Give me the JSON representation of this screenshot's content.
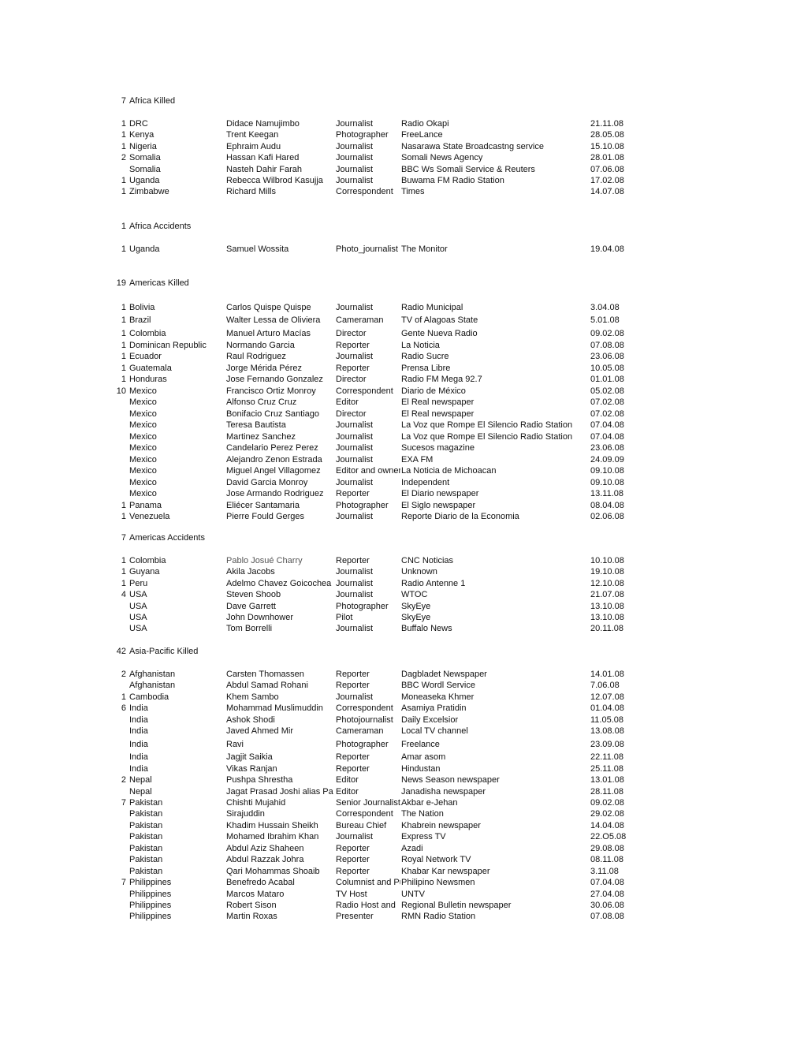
{
  "sections": [
    {
      "count": "7",
      "title": "Africa Killed",
      "rows": [
        {
          "count": "1",
          "country": "DRC",
          "name": "Didace Namujimbo",
          "role": "Journalist",
          "outlet": "Radio Okapi",
          "date": "21.11.08"
        },
        {
          "count": "1",
          "country": "Kenya",
          "name": "Trent Keegan",
          "role": "Photographer",
          "outlet": "FreeLance",
          "date": "28.05.08"
        },
        {
          "count": "1",
          "country": "Nigeria",
          "name": "Ephraim Audu",
          "role": "Journalist",
          "outlet": "Nasarawa State Broadcastng service",
          "date": "15.10.08"
        },
        {
          "count": "2",
          "country": "Somalia",
          "name": "Hassan Kafi Hared",
          "role": "Journalist",
          "outlet": "Somali News Agency",
          "date": "28.01.08"
        },
        {
          "count": "",
          "country": "Somalia",
          "name": "Nasteh Dahir Farah",
          "role": "Journalist",
          "outlet": "BBC Ws Somali Service & Reuters",
          "date": "07.06.08"
        },
        {
          "count": "1",
          "country": "Uganda",
          "name": "Rebecca Wilbrod Kasujja",
          "role": "Journalist",
          "outlet": "Buwama FM Radio Station",
          "date": "17.02.08"
        },
        {
          "count": "1",
          "country": "Zimbabwe",
          "name": "Richard Mills",
          "role": "Correspondent",
          "outlet": "Times",
          "date": "14.07.08"
        }
      ]
    },
    {
      "count": "1",
      "title": "Africa Accidents",
      "rows": [
        {
          "count": "1",
          "country": "Uganda",
          "name": "Samuel Wossita",
          "role": "Photo_journalist",
          "outlet": "The Monitor",
          "date": "19.04.08"
        }
      ]
    },
    {
      "count": "19",
      "title": "Americas Killed",
      "rows": [
        {
          "count": "1",
          "country": "Bolivia",
          "name": "Carlos Quispe Quispe",
          "role": "Journalist",
          "outlet": "Radio Municipal",
          "date": "3.04.08"
        },
        {
          "count": "1",
          "country": "Brazil",
          "name": "Walter Lessa de Oliviera",
          "role": "Cameraman",
          "outlet": "TV of Alagoas State",
          "date": "5.01.08"
        },
        {
          "count": "1",
          "country": "Colombia",
          "name": "Manuel Arturo Macías",
          "role": "Director",
          "outlet": "Gente Nueva Radio",
          "date": "09.02.08"
        },
        {
          "count": "1",
          "country": "Dominican Republic",
          "name": "Normando Garcia",
          "role": "Reporter",
          "outlet": "La Noticia",
          "date": "07.08.08"
        },
        {
          "count": "1",
          "country": "Ecuador",
          "name": "Raul Rodriguez",
          "role": "Journalist",
          "outlet": "Radio Sucre",
          "date": "23.06.08"
        },
        {
          "count": "1",
          "country": "Guatemala",
          "name": "Jorge Mérida Pérez",
          "role": "Reporter",
          "outlet": "Prensa Libre",
          "date": "10.05.08"
        },
        {
          "count": "1",
          "country": "Honduras",
          "name": "Jose Fernando Gonzalez",
          "role": "Director",
          "outlet": "Radio FM Mega 92.7",
          "date": "01.01.08"
        },
        {
          "count": "10",
          "country": "Mexico",
          "name": "Francisco Ortiz Monroy",
          "role": "Correspondent",
          "outlet": "Diario de México",
          "date": "05.02.08"
        },
        {
          "count": "",
          "country": "Mexico",
          "name": "Alfonso Cruz Cruz",
          "role": "Editor",
          "outlet": "El Real newspaper",
          "date": "07.02.08"
        },
        {
          "count": "",
          "country": "Mexico",
          "name": "Bonifacio Cruz Santiago",
          "role": "Director",
          "outlet": "El Real newspaper",
          "date": "07.02.08"
        },
        {
          "count": "",
          "country": "Mexico",
          "name": "Teresa Bautista",
          "role": "Journalist",
          "outlet": "La Voz que Rompe El Silencio Radio Station",
          "date": "07.04.08"
        },
        {
          "count": "",
          "country": "Mexico",
          "name": "Martinez Sanchez",
          "role": "Journalist",
          "outlet": "La Voz que Rompe El Silencio Radio Station",
          "date": "07.04.08"
        },
        {
          "count": "",
          "country": "Mexico",
          "name": "Candelario Perez Perez",
          "role": "Journalist",
          "outlet": "Sucesos magazine",
          "date": "23.06.08"
        },
        {
          "count": "",
          "country": "Mexico",
          "name": "Alejandro Zenon Estrada",
          "role": "Journalist",
          "outlet": "EXA FM",
          "date": "24.09.09"
        },
        {
          "count": "",
          "country": "Mexico",
          "name": "Miguel Angel Villagomez",
          "role": "Editor and owner",
          "outlet": "La Noticia de Michoacan",
          "date": "09.10.08"
        },
        {
          "count": "",
          "country": "Mexico",
          "name": "David Garcia Monroy",
          "role": "Journalist",
          "outlet": "Independent",
          "date": "09.10.08"
        },
        {
          "count": "",
          "country": "Mexico",
          "name": "Jose Armando Rodriguez",
          "role": "Reporter",
          "outlet": "El Diario newspaper",
          "date": "13.11.08"
        },
        {
          "count": "1",
          "country": "Panama",
          "name": "Eliécer Santamaria",
          "role": "Photographer",
          "outlet": "El Siglo newspaper",
          "date": "08.04.08"
        },
        {
          "count": "1",
          "country": "Venezuela",
          "name": "Pierre Fould Gerges",
          "role": "Journalist",
          "outlet": "Reporte Diario de la Economia",
          "date": "02.06.08"
        }
      ]
    },
    {
      "count": "7",
      "title": "Americas Accidents",
      "rows": [
        {
          "count": "1",
          "country": "Colombia",
          "name": "Pablo Josué Charry",
          "role": "Reporter",
          "outlet": "CNC Noticias",
          "date": "10.10.08",
          "grey_name": true
        },
        {
          "count": "1",
          "country": "Guyana",
          "name": "Akila  Jacobs",
          "role": "Journalist",
          "outlet": "Unknown",
          "date": "19.10.08"
        },
        {
          "count": "1",
          "country": "Peru",
          "name": "Adelmo Chavez Goicochea",
          "role": "Journalist",
          "outlet": "Radio Antenne 1",
          "date": "12.10.08"
        },
        {
          "count": "4",
          "country": "USA",
          "name": "Steven Shoob",
          "role": "Journalist",
          "outlet": "WTOC",
          "date": "21.07.08"
        },
        {
          "count": "",
          "country": "USA",
          "name": "Dave Garrett",
          "role": "Photographer",
          "outlet": "SkyEye",
          "date": "13.10.08"
        },
        {
          "count": "",
          "country": "USA",
          "name": "John  Downhower",
          "role": "Pilot",
          "outlet": "SkyEye",
          "date": "13.10.08"
        },
        {
          "count": "",
          "country": "USA",
          "name": "Tom Borrelli",
          "role": "Journalist",
          "outlet": "Buffalo News",
          "date": "20.11.08"
        }
      ]
    },
    {
      "count": "42",
      "title": "Asia-Pacific Killed",
      "rows": [
        {
          "count": "2",
          "country": "Afghanistan",
          "name": "Carsten Thomassen",
          "role": "Reporter",
          "outlet": "Dagbladet Newspaper",
          "date": "14.01.08"
        },
        {
          "count": "",
          "country": "Afghanistan",
          "name": "Abdul Samad Rohani",
          "role": "Reporter",
          "outlet": "BBC Wordl Service",
          "date": "7.06.08"
        },
        {
          "count": "1",
          "country": "Cambodia",
          "name": "Khem Sambo",
          "role": "Journalist",
          "outlet": "Moneaseka Khmer",
          "date": "12.07.08"
        },
        {
          "count": "6",
          "country": "India",
          "name": "Mohammad Muslimuddin",
          "role": "Correspondent",
          "outlet": "Asamiya Pratidin",
          "date": "01.04.08"
        },
        {
          "count": "",
          "country": "India",
          "name": "Ashok Shodi",
          "role": "Photojournalist",
          "outlet": "Daily Excelsior",
          "date": "11.05.08"
        },
        {
          "count": "",
          "country": "India",
          "name": "Javed Ahmed Mir",
          "role": "Cameraman",
          "outlet": "Local TV channel",
          "date": "13.08.08"
        },
        {
          "count": "",
          "country": "India",
          "name": "Ravi",
          "role": "Photographer",
          "outlet": "Freelance",
          "date": "23.09.08"
        },
        {
          "count": "",
          "country": "India",
          "name": "Jagjit Saikia",
          "role": "Reporter",
          "outlet": "Amar asom",
          "date": "22.11.08"
        },
        {
          "count": "",
          "country": "India",
          "name": "Vikas Ranjan",
          "role": "Reporter",
          "outlet": "Hindustan",
          "date": "25.11.08"
        },
        {
          "count": "2",
          "country": "Nepal",
          "name": "Pushpa Shrestha",
          "role": "Editor",
          "outlet": "News Season newspaper",
          "date": "13.01.08"
        },
        {
          "count": "",
          "country": "Nepal",
          "name": "Jagat Prasad Joshi alias Pa",
          "role": "Editor",
          "outlet": "Janadisha newspaper",
          "date": "28.11.08"
        },
        {
          "count": "7",
          "country": "Pakistan",
          "name": "Chishti Mujahid",
          "role": "Senior Journalist",
          "outlet": "Akbar e-Jehan",
          "date": "09.02.08"
        },
        {
          "count": "",
          "country": "Pakistan",
          "name": "Sirajuddin",
          "role": "Correspondent",
          "outlet": "The Nation",
          "date": "29.02.08"
        },
        {
          "count": "",
          "country": "Pakistan",
          "name": "Khadim Hussain Sheikh",
          "role": "Bureau Chief",
          "outlet": "Khabrein newspaper",
          "date": "14.04.08"
        },
        {
          "count": "",
          "country": "Pakistan",
          "name": "Mohamed Ibrahim Khan",
          "role": "Journalist",
          "outlet": "Express TV",
          "date": "22.O5.08"
        },
        {
          "count": "",
          "country": "Pakistan",
          "name": "Abdul Aziz Shaheen",
          "role": "Reporter",
          "outlet": "Azadi",
          "date": "29.08.08"
        },
        {
          "count": "",
          "country": "Pakistan",
          "name": "Abdul Razzak Johra",
          "role": "Reporter",
          "outlet": "Royal Network TV",
          "date": "08.11.08"
        },
        {
          "count": "",
          "country": "Pakistan",
          "name": "Qari Mohammas Shoaib",
          "role": "Reporter",
          "outlet": "Khabar Kar newspaper",
          "date": "3.11.08"
        },
        {
          "count": "7",
          "country": "Philippines",
          "name": "Benefredo Acabal",
          "role": "Columnist and Publisher",
          "outlet": "Philipino Newsmen",
          "date": "07.04.08"
        },
        {
          "count": "",
          "country": "Philippines",
          "name": "Marcos Mataro",
          "role": "TV Host",
          "outlet": "UNTV",
          "date": "27.04.08"
        },
        {
          "count": "",
          "country": "Philippines",
          "name": "Robert Sison",
          "role": "Radio Host and",
          "outlet": "Regional Bulletin newspaper",
          "date": "30.06.08"
        },
        {
          "count": "",
          "country": "Philippines",
          "name": "Martin Roxas",
          "role": "Presenter",
          "outlet": "RMN Radio Station",
          "date": "07.08.08"
        }
      ]
    }
  ]
}
